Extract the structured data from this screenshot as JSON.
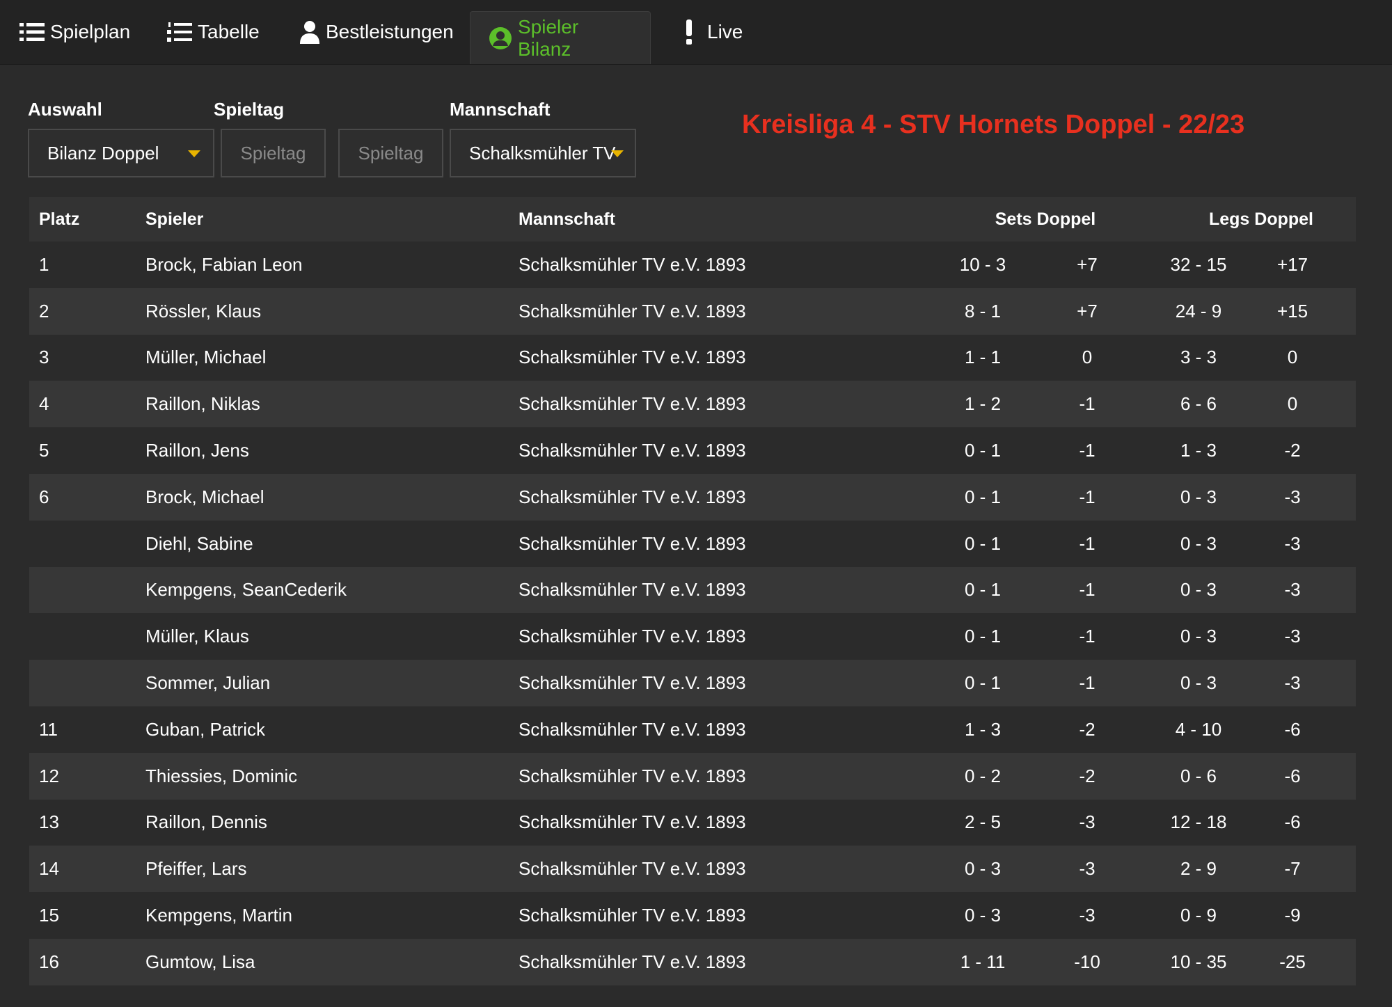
{
  "nav": {
    "tabs": [
      {
        "label": "Spielplan",
        "icon": "list-icon"
      },
      {
        "label": "Tabelle",
        "icon": "numbered-list-icon"
      },
      {
        "label": "Bestleistungen",
        "icon": "user-icon"
      },
      {
        "label": "Spieler Bilanz",
        "icon": "user-circle-icon",
        "active": true
      },
      {
        "label": "Live",
        "icon": "exclamation-icon"
      }
    ]
  },
  "filters": {
    "auswahl_label": "Auswahl",
    "auswahl_value": "Bilanz Doppel",
    "spieltag_label": "Spieltag",
    "spieltag_from_placeholder": "Spieltag",
    "spieltag_to_placeholder": "Spieltag",
    "mannschaft_label": "Mannschaft",
    "mannschaft_value": "Schalksmühler TV"
  },
  "league_title": "Kreisliga 4 - STV Hornets Doppel - 22/23",
  "colors": {
    "accent": "#5cbf2a",
    "title": "#e8301f",
    "caret": "#e8b400"
  },
  "table": {
    "headers": {
      "platz": "Platz",
      "spieler": "Spieler",
      "mannschaft": "Mannschaft",
      "sets": "Sets Doppel",
      "legs": "Legs Doppel"
    },
    "rows": [
      {
        "platz": "1",
        "spieler": "Brock, Fabian Leon",
        "mannschaft": "Schalksmühler TV e.V. 1893",
        "sets": "10 - 3",
        "sets_diff": "+7",
        "legs": "32 - 15",
        "legs_diff": "+17"
      },
      {
        "platz": "2",
        "spieler": "Rössler, Klaus",
        "mannschaft": "Schalksmühler TV e.V. 1893",
        "sets": "8 - 1",
        "sets_diff": "+7",
        "legs": "24 - 9",
        "legs_diff": "+15"
      },
      {
        "platz": "3",
        "spieler": "Müller, Michael",
        "mannschaft": "Schalksmühler TV e.V. 1893",
        "sets": "1 - 1",
        "sets_diff": "0",
        "legs": "3 - 3",
        "legs_diff": "0"
      },
      {
        "platz": "4",
        "spieler": "Raillon, Niklas",
        "mannschaft": "Schalksmühler TV e.V. 1893",
        "sets": "1 - 2",
        "sets_diff": "-1",
        "legs": "6 - 6",
        "legs_diff": "0"
      },
      {
        "platz": "5",
        "spieler": "Raillon, Jens",
        "mannschaft": "Schalksmühler TV e.V. 1893",
        "sets": "0 - 1",
        "sets_diff": "-1",
        "legs": "1 - 3",
        "legs_diff": "-2"
      },
      {
        "platz": "6",
        "spieler": "Brock, Michael",
        "mannschaft": "Schalksmühler TV e.V. 1893",
        "sets": "0 - 1",
        "sets_diff": "-1",
        "legs": "0 - 3",
        "legs_diff": "-3"
      },
      {
        "platz": "",
        "spieler": "Diehl, Sabine",
        "mannschaft": "Schalksmühler TV e.V. 1893",
        "sets": "0 - 1",
        "sets_diff": "-1",
        "legs": "0 - 3",
        "legs_diff": "-3"
      },
      {
        "platz": "",
        "spieler": "Kempgens, SeanCederik",
        "mannschaft": "Schalksmühler TV e.V. 1893",
        "sets": "0 - 1",
        "sets_diff": "-1",
        "legs": "0 - 3",
        "legs_diff": "-3"
      },
      {
        "platz": "",
        "spieler": "Müller, Klaus",
        "mannschaft": "Schalksmühler TV e.V. 1893",
        "sets": "0 - 1",
        "sets_diff": "-1",
        "legs": "0 - 3",
        "legs_diff": "-3"
      },
      {
        "platz": "",
        "spieler": "Sommer, Julian",
        "mannschaft": "Schalksmühler TV e.V. 1893",
        "sets": "0 - 1",
        "sets_diff": "-1",
        "legs": "0 - 3",
        "legs_diff": "-3"
      },
      {
        "platz": "11",
        "spieler": "Guban, Patrick",
        "mannschaft": "Schalksmühler TV e.V. 1893",
        "sets": "1 - 3",
        "sets_diff": "-2",
        "legs": "4 - 10",
        "legs_diff": "-6"
      },
      {
        "platz": "12",
        "spieler": "Thiessies, Dominic",
        "mannschaft": "Schalksmühler TV e.V. 1893",
        "sets": "0 - 2",
        "sets_diff": "-2",
        "legs": "0 - 6",
        "legs_diff": "-6"
      },
      {
        "platz": "13",
        "spieler": "Raillon, Dennis",
        "mannschaft": "Schalksmühler TV e.V. 1893",
        "sets": "2 - 5",
        "sets_diff": "-3",
        "legs": "12 - 18",
        "legs_diff": "-6"
      },
      {
        "platz": "14",
        "spieler": "Pfeiffer, Lars",
        "mannschaft": "Schalksmühler TV e.V. 1893",
        "sets": "0 - 3",
        "sets_diff": "-3",
        "legs": "2 - 9",
        "legs_diff": "-7"
      },
      {
        "platz": "15",
        "spieler": "Kempgens, Martin",
        "mannschaft": "Schalksmühler TV e.V. 1893",
        "sets": "0 - 3",
        "sets_diff": "-3",
        "legs": "0 - 9",
        "legs_diff": "-9"
      },
      {
        "platz": "16",
        "spieler": "Gumtow, Lisa",
        "mannschaft": "Schalksmühler TV e.V. 1893",
        "sets": "1 - 11",
        "sets_diff": "-10",
        "legs": "10 - 35",
        "legs_diff": "-25"
      }
    ]
  }
}
